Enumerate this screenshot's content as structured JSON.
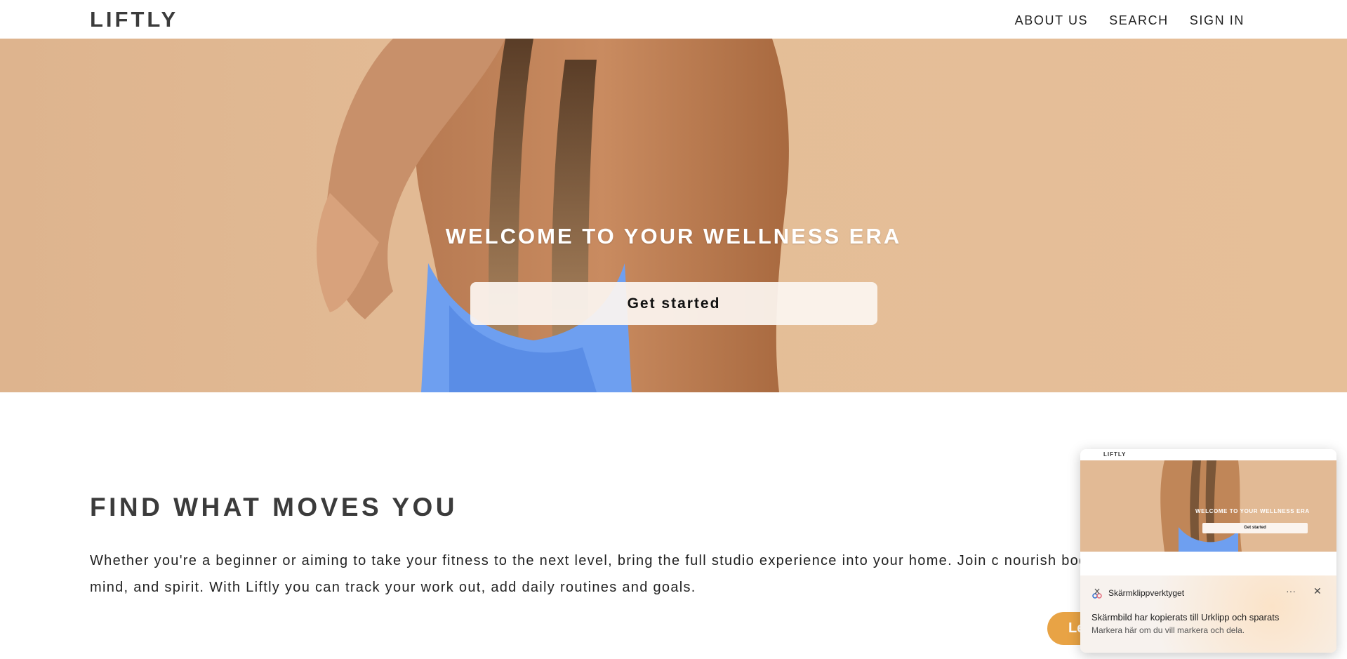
{
  "nav": {
    "logo": "LIFTLY",
    "links": [
      "ABOUT US",
      "SEARCH",
      "SIGN IN"
    ]
  },
  "hero": {
    "title": "WELCOME TO YOUR WELLNESS ERA",
    "button_label": "Get started"
  },
  "section": {
    "title": "FIND WHAT MOVES YOU",
    "body": "Whether you're a beginner or aiming to take your fitness to the next level, bring the full studio experience into your home. Join c nourish body, mind, and spirit. With Liftly you can track your work out, add daily routines and goals.",
    "learn_button": "Le"
  },
  "toast": {
    "thumbnail": {
      "logo": "LIFTLY",
      "title": "WELCOME TO YOUR WELLNESS ERA",
      "button": "Get started"
    },
    "app_name": "Skärmklippverktyget",
    "more_icon": "···",
    "close_icon": "✕",
    "title": "Skärmbild har kopierats till Urklipp och sparats",
    "subtitle": "Markera här om du vill markera och dela."
  },
  "colors": {
    "hero_bg": "#e4bd97",
    "accent": "#e8a345",
    "text_dark": "#3b3b3b"
  }
}
